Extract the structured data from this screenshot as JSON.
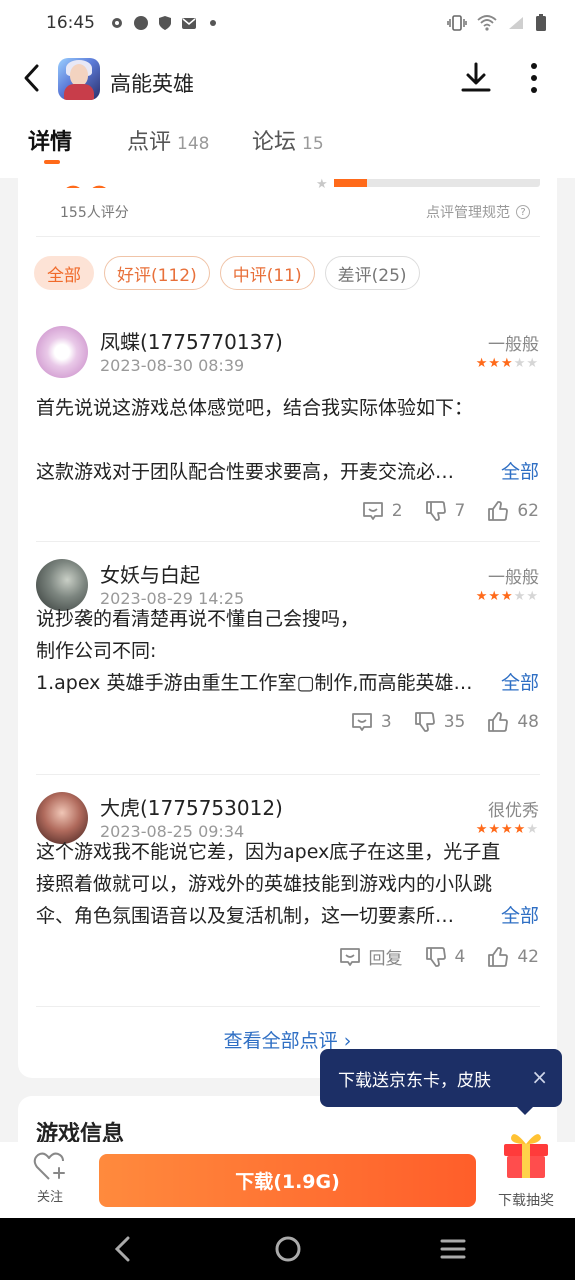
{
  "status_bar": {
    "time": "16:45"
  },
  "app_bar": {
    "title": "高能英雄"
  },
  "tabs": [
    {
      "label": "详情",
      "count": ""
    },
    {
      "label": "点评",
      "count": "148"
    },
    {
      "label": "论坛",
      "count": "15"
    }
  ],
  "summary": {
    "raters": "155人评分",
    "rules": "点评管理规范",
    "rating_bar_fraction": 0.16
  },
  "filters": [
    "全部",
    "好评(112)",
    "中评(11)",
    "差评(25)"
  ],
  "reviews": [
    {
      "name": "凤蝶(1775770137)",
      "date": "2023-08-30  08:39",
      "verdict": "一般般",
      "stars": 3,
      "line1": "首先说说这游戏总体感觉吧，结合我实际体验如下：",
      "line2": "",
      "line3": "这款游戏对于团队配合性要求要高，开麦交流必…",
      "more": "全部",
      "comments": "2",
      "dislikes": "7",
      "likes": "62"
    },
    {
      "name": "女妖与白起",
      "date": "2023-08-29  14:25",
      "verdict": "一般般",
      "stars": 3,
      "line1": "说抄袭的看清楚再说不懂自己会搜吗，",
      "line2": "制作公司不同:",
      "line3": "1.apex 英雄手游由重生工作室▢制作,而高能英雄…",
      "more": "全部",
      "comments": "3",
      "dislikes": "35",
      "likes": "48"
    },
    {
      "name": "大虎(1775753012)",
      "date": "2023-08-25  09:34",
      "verdict": "很优秀",
      "stars": 4,
      "line1": "这个游戏我不能说它差，因为apex底子在这里，光子直",
      "line2": "接照着做就可以，游戏外的英雄技能到游戏内的小队跳",
      "line3": "伞、角色氛围语音以及复活机制，这一切要素所…",
      "more": "全部",
      "comments": "回复",
      "dislikes": "4",
      "likes": "42"
    }
  ],
  "see_all": "查看全部点评 ›",
  "game_info_title": "游戏信息",
  "tooltip": {
    "text": "下载送京东卡，皮肤",
    "close": "×"
  },
  "bottom": {
    "follow": "关注",
    "download": "下载(1.9G)",
    "lottery": "下载抽奖"
  },
  "colors": {
    "accent": "#ff6a1a",
    "link": "#2f6fc4",
    "tooltip_bg": "#1c2f66"
  }
}
